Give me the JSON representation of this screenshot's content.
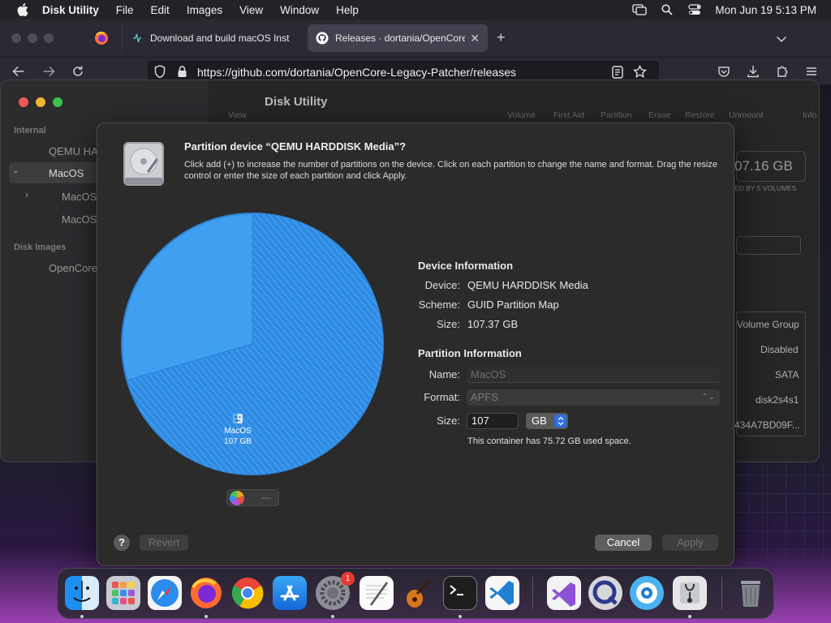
{
  "menubar": {
    "app_name": "Disk Utility",
    "menus": [
      "File",
      "Edit",
      "Images",
      "View",
      "Window",
      "Help"
    ],
    "clock": "Mon Jun 19  5:13 PM"
  },
  "browser": {
    "tabs": [
      {
        "label": "Download and build macOS Inst",
        "icon": "pulse-icon"
      },
      {
        "label": "Releases · dortania/OpenCore-L",
        "icon": "github-icon",
        "active": true
      }
    ],
    "new_tab_label": "+",
    "url": "https://github.com/dortania/OpenCore-Legacy-Patcher/releases"
  },
  "disk_utility": {
    "title": "Disk Utility",
    "sidebar": {
      "section_internal": "Internal",
      "items": [
        "QEMU HA",
        "MacOS",
        "MacOS",
        "MacOS"
      ],
      "section_disk_images": "Disk Images",
      "image_items": [
        "OpenCore"
      ]
    },
    "toolbar": [
      "View",
      "Volume",
      "First Aid",
      "Partition",
      "Erase",
      "Restore",
      "Unmount",
      "Info"
    ],
    "capacity": "07.16 GB",
    "shared_note": "ED BY 5 VOLUMES",
    "details": [
      "Volume Group",
      "Disabled",
      "SATA",
      "disk2s4s1",
      "434A7BD09F..."
    ]
  },
  "sheet": {
    "title": "Partition device “QEMU HARDDISK Media”?",
    "description": "Click add (+) to increase the number of partitions on the device. Click on each partition to change the name and format. Drag the resize control or enter the size of each partition and click Apply.",
    "device_info_heading": "Device Information",
    "device_label": "Device:",
    "device_value": "QEMU HARDDISK Media",
    "scheme_label": "Scheme:",
    "scheme_value": "GUID Partition Map",
    "size_label": "Size:",
    "size_value": "107.37 GB",
    "partition_info_heading": "Partition Information",
    "name_label": "Name:",
    "name_value": "MacOS",
    "format_label": "Format:",
    "format_value": "APFS",
    "psize_label": "Size:",
    "psize_value": "107",
    "unit_value": "GB",
    "used_note": "This container has 75.72 GB used space.",
    "pie_label_name": "MacOS",
    "pie_label_size": "107 GB",
    "used_fraction": 0.7052,
    "minus_label": "—",
    "help_label": "?",
    "revert_label": "Revert",
    "cancel_label": "Cancel",
    "apply_label": "Apply"
  },
  "dock": {
    "apps": [
      "Finder",
      "Launchpad",
      "Safari",
      "Firefox",
      "Chrome",
      "App Store",
      "System Settings",
      "TextEdit",
      "GarageBand",
      "Terminal",
      "Visual Studio Code",
      "Visual Studio",
      "QuickTime Player",
      "Disk Utility Alt",
      "Disk Utility",
      "Trash"
    ],
    "settings_badge": "1"
  }
}
